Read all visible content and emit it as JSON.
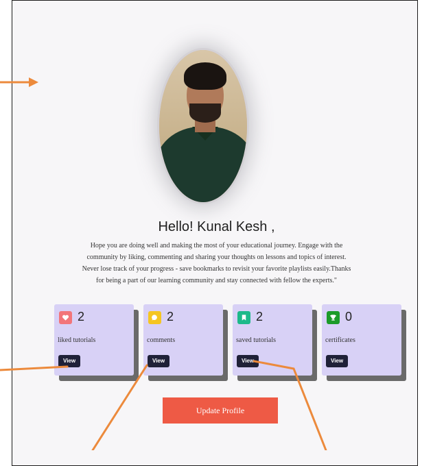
{
  "greeting": "Hello! Kunal Kesh ,",
  "intro_lines": [
    "Hope you are doing well and making the most of your educational journey. Engage with the",
    "community by liking, commenting and sharing your thoughts on lessons and topics of interest.",
    "Never lose track of your progress - save bookmarks to revisit your favorite playlists easily.Thanks",
    "for being a part of our learning community and stay connected with fellow the experts.\""
  ],
  "cards": [
    {
      "count": "2",
      "label": "liked tutorials",
      "button": "View",
      "icon": "heart-icon",
      "color": "#f2757a"
    },
    {
      "count": "2",
      "label": "comments",
      "button": "View",
      "icon": "comment-icon",
      "color": "#f5c521"
    },
    {
      "count": "2",
      "label": "saved tutorials",
      "button": "View",
      "icon": "bookmark-icon",
      "color": "#1db98a"
    },
    {
      "count": "0",
      "label": "certificates",
      "button": "View",
      "icon": "trophy-icon",
      "color": "#1c9b29"
    }
  ],
  "update_button": "Update Profile",
  "colors": {
    "card_bg": "#d8d1f6",
    "button_dark": "#1f2138",
    "accent": "#ee5a45",
    "annotation": "#ec8a3c"
  }
}
